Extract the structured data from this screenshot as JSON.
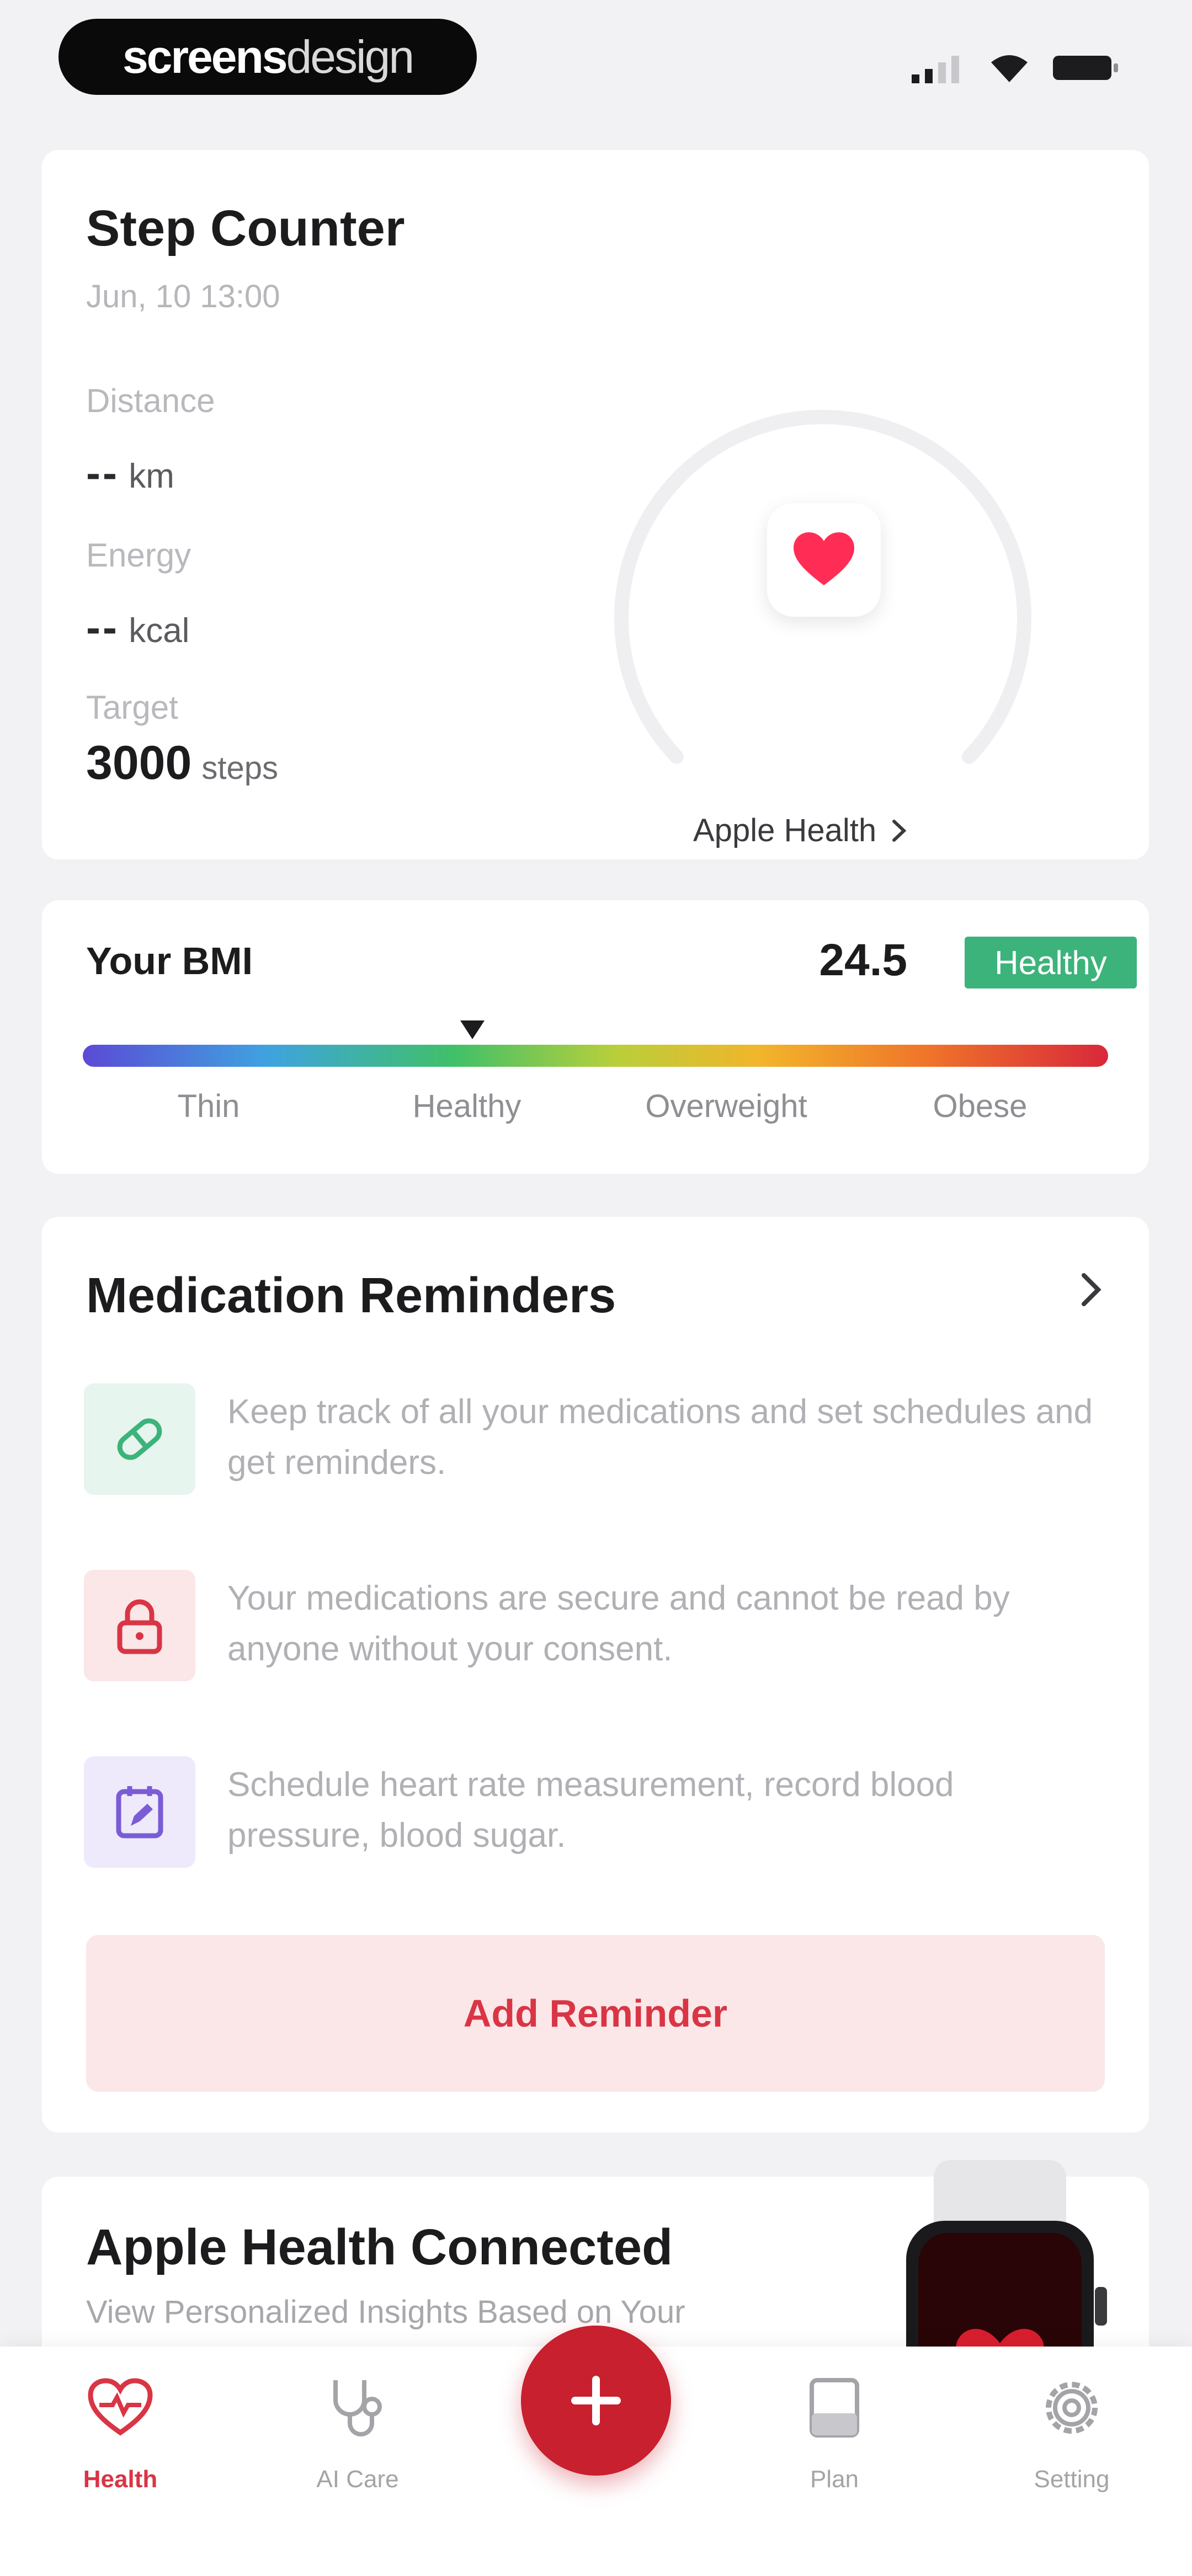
{
  "colors": {
    "accent": "#d93545",
    "fab": "#c8202e",
    "healthy_badge": "#3cb37a",
    "background": "#f2f2f4",
    "card": "#ffffff"
  },
  "status_bar": {
    "brand_bold": "screens",
    "brand_light": "design",
    "icons": [
      "cellular-signal-icon",
      "wifi-icon",
      "battery-icon"
    ]
  },
  "step_counter": {
    "title": "Step Counter",
    "date": "Jun, 10 13:00",
    "distance_label": "Distance",
    "distance_value": "--",
    "distance_unit": "km",
    "energy_label": "Energy",
    "energy_value": "--",
    "energy_unit": "kcal",
    "target_label": "Target",
    "target_value": "3000",
    "target_unit": "steps",
    "source_link": "Apple Health",
    "source_icon": "heart-icon"
  },
  "bmi": {
    "title": "Your BMI",
    "value": "24.5",
    "badge": "Healthy",
    "categories": [
      "Thin",
      "Healthy",
      "Overweight",
      "Obese"
    ],
    "pointer_fraction": 0.38
  },
  "medication": {
    "title": "Medication Reminders",
    "items": [
      {
        "icon": "pill-icon",
        "text": "Keep track of all your medications and set schedules and get reminders."
      },
      {
        "icon": "lock-icon",
        "text": "Your medications are secure and cannot be read by anyone without your consent."
      },
      {
        "icon": "calendar-edit-icon",
        "text": "Schedule heart rate measurement, record blood pressure, blood sugar."
      }
    ],
    "add_button": "Add Reminder"
  },
  "apple_health": {
    "title": "Apple Health Connected",
    "subtitle": "View Personalized Insights Based on Your"
  },
  "tab_bar": {
    "tabs": [
      {
        "label": "Health",
        "icon": "heart-pulse-icon",
        "active": true
      },
      {
        "label": "AI Care",
        "icon": "stethoscope-icon",
        "active": false
      },
      {
        "label": "Plan",
        "icon": "book-icon",
        "active": false
      },
      {
        "label": "Setting",
        "icon": "gear-icon",
        "active": false
      }
    ],
    "fab_icon": "plus-icon"
  }
}
